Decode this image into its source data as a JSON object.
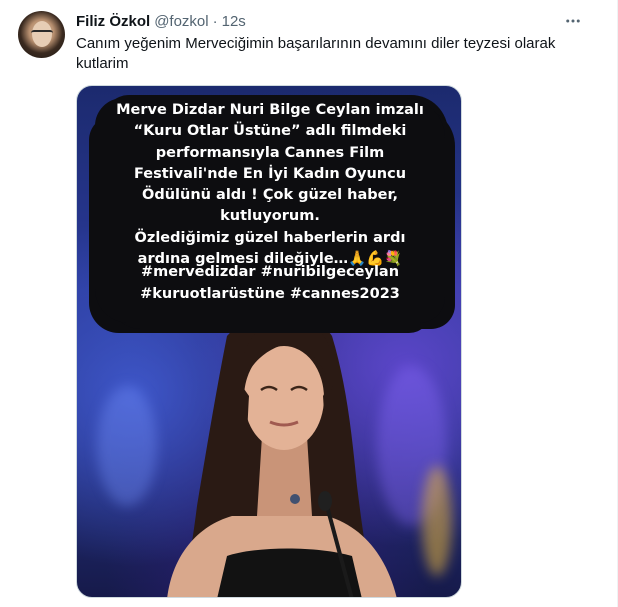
{
  "tweet": {
    "display_name": "Filiz Özkol",
    "handle": "@fozkol",
    "separator": "·",
    "time": "12s",
    "more_icon": "more-horizontal-icon",
    "text": "Canım yeğenim Merveciğimin  başarılarının devamını diler teyzesi olarak kutlarim"
  },
  "media": {
    "overlay_lines": [
      "Merve Dizdar Nuri Bilge Ceylan imzalı",
      "“Kuru Otlar Üstüne” adlı filmdeki",
      "performansıyla Cannes Film",
      "Festivali'nde En İyi Kadın Oyuncu",
      "Ödülünü aldı ! Çok güzel haber,",
      "kutluyorum.",
      "Özlediğimiz güzel haberlerin ardı",
      "ardına gelmesi dileğiyle…🙏💪💐"
    ],
    "hashtag_lines": [
      "#mervedizdar #nuribilgeceylan",
      "#kuruotlarüstüne #cannes2023"
    ]
  }
}
